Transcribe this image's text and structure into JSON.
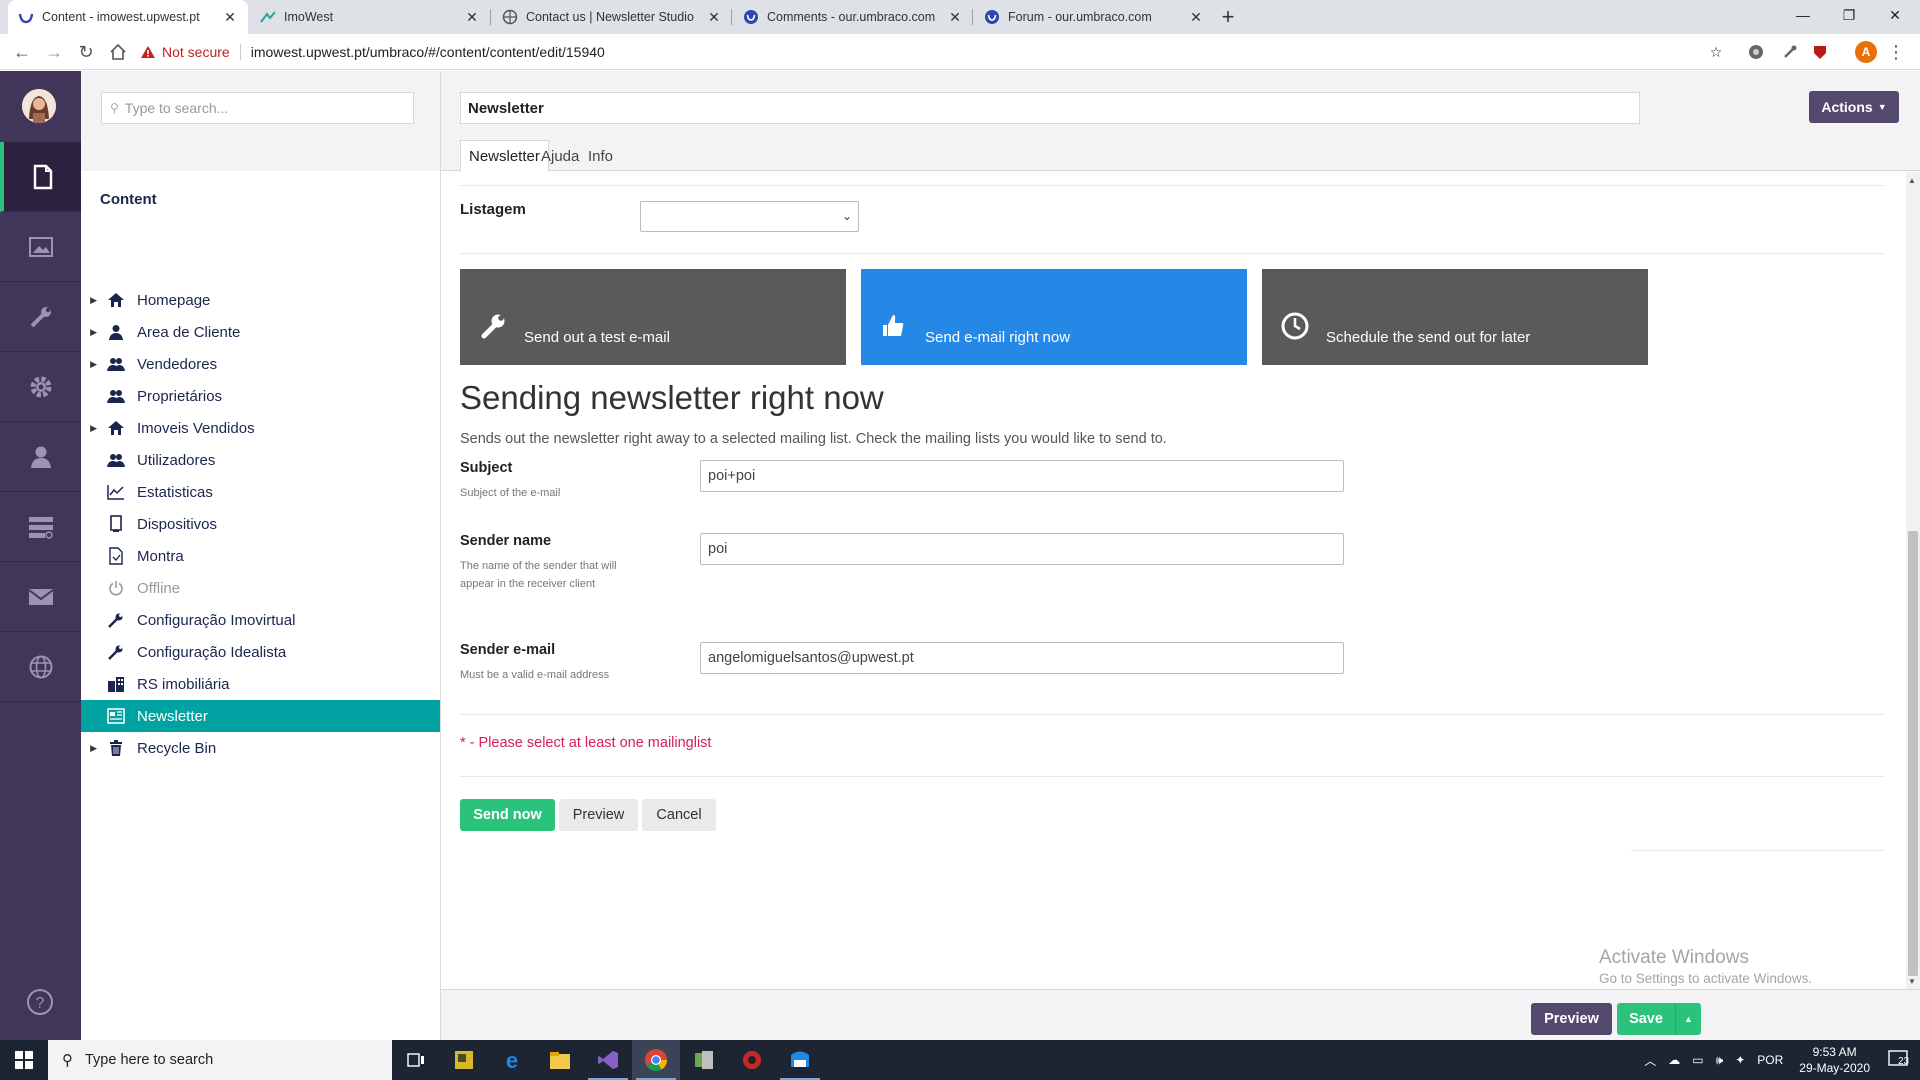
{
  "browser": {
    "tabs": [
      {
        "title": "Content - imowest.upwest.pt",
        "active": true,
        "icon": "umbraco-favicon"
      },
      {
        "title": "ImoWest",
        "active": false,
        "icon": "imowest-favicon"
      },
      {
        "title": "Contact us | Newsletter Studio",
        "active": false,
        "icon": "globe-favicon"
      },
      {
        "title": "Comments - our.umbraco.com",
        "active": false,
        "icon": "umbraco-favicon"
      },
      {
        "title": "Forum - our.umbraco.com",
        "active": false,
        "icon": "umbraco-favicon"
      }
    ],
    "new_tab": "+",
    "security": "Not secure",
    "url": "imowest.upwest.pt/umbraco/#/content/content/edit/15940",
    "profile_initial": "A"
  },
  "tree": {
    "search_placeholder": "Type to search...",
    "title": "Content",
    "nodes": [
      {
        "label": "Homepage",
        "icon": "home-icon",
        "expandable": true
      },
      {
        "label": "Area de Cliente",
        "icon": "user-icon",
        "expandable": true
      },
      {
        "label": "Vendedores",
        "icon": "users-icon",
        "expandable": true
      },
      {
        "label": "Proprietários",
        "icon": "users-icon",
        "expandable": false
      },
      {
        "label": "Imoveis Vendidos",
        "icon": "home-icon",
        "expandable": true
      },
      {
        "label": "Utilizadores",
        "icon": "users-icon",
        "expandable": false
      },
      {
        "label": "Estatisticas",
        "icon": "chart-icon",
        "expandable": false
      },
      {
        "label": "Dispositivos",
        "icon": "device-icon",
        "expandable": false
      },
      {
        "label": "Montra",
        "icon": "document-icon",
        "expandable": false
      },
      {
        "label": "Offline",
        "icon": "power-icon",
        "expandable": false
      },
      {
        "label": "Configuração Imovirtual",
        "icon": "wrench-icon",
        "expandable": false
      },
      {
        "label": "Configuração Idealista",
        "icon": "wrench-icon",
        "expandable": false
      },
      {
        "label": "RS imobiliária",
        "icon": "building-icon",
        "expandable": false
      },
      {
        "label": "Newsletter",
        "icon": "newsletter-icon",
        "expandable": false
      },
      {
        "label": "Recycle Bin",
        "icon": "trash-icon",
        "expandable": true
      }
    ]
  },
  "editor": {
    "node_name": "Newsletter",
    "actions_label": "Actions",
    "tabs": [
      "Newsletter",
      "Ajuda",
      "Info"
    ],
    "listagem_label": "Listagem",
    "listagem_value": "",
    "modes": [
      {
        "label": "Send out a test e-mail",
        "icon": "wrench-icon",
        "selected": false
      },
      {
        "label": "Send e-mail right now",
        "icon": "thumbs-up-icon",
        "selected": true
      },
      {
        "label": "Schedule the send out for later",
        "icon": "clock-icon",
        "selected": false
      }
    ],
    "heading": "Sending newsletter right now",
    "description": "Sends out the newsletter right away to a selected mailing list. Check the mailing lists you would like to send to.",
    "fields": {
      "subject": {
        "label": "Subject",
        "desc": "Subject of the e-mail",
        "value": "poi+poi"
      },
      "sender_name": {
        "label": "Sender name",
        "desc": "The name of the sender that will appear in the receiver client",
        "value": "poi"
      },
      "sender_email": {
        "label": "Sender e-mail",
        "desc": "Must be a valid e-mail address",
        "value": "angelomiguelsantos@upwest.pt"
      }
    },
    "error": "* - Please select at least one mailinglist",
    "buttons": {
      "send_now": "Send now",
      "preview": "Preview",
      "cancel": "Cancel"
    },
    "footer": {
      "preview": "Preview",
      "save": "Save"
    },
    "watermark": {
      "line1": "Activate Windows",
      "line2": "Go to Settings to activate Windows."
    }
  },
  "colors": {
    "section_bar": "#413659",
    "accent_green": "#2bc37c",
    "selected_tree": "#00a3a1",
    "mode_selected": "#2688e6",
    "mode_default": "#5a5a5a",
    "error": "#d42054"
  },
  "taskbar": {
    "search_placeholder": "Type here to search",
    "language": "POR",
    "time": "9:53 AM",
    "date": "29-May-2020",
    "notifications": "23"
  }
}
